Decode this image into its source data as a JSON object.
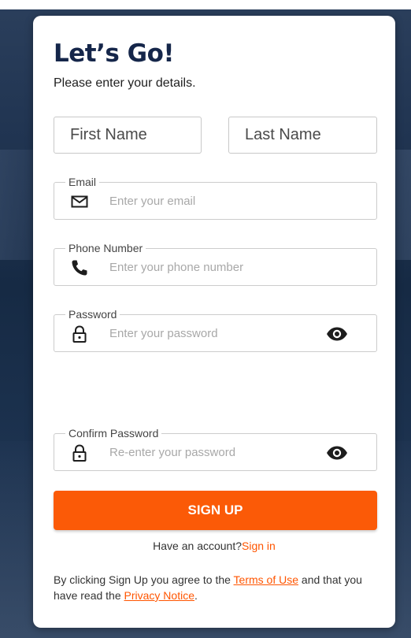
{
  "header": {
    "title": "Let’s Go!",
    "subtitle": "Please enter your details."
  },
  "form": {
    "first_name": {
      "placeholder": "First Name",
      "value": ""
    },
    "last_name": {
      "placeholder": "Last Name",
      "value": ""
    },
    "email": {
      "label": "Email",
      "placeholder": "Enter your email",
      "value": "",
      "icon": "envelope-icon"
    },
    "phone": {
      "label": "Phone Number",
      "placeholder": "Enter your phone number",
      "value": "",
      "icon": "phone-icon"
    },
    "password": {
      "label": "Password",
      "placeholder": "Enter your password",
      "value": "",
      "icon": "lock-icon",
      "toggle_icon": "eye-icon"
    },
    "confirm_password": {
      "label": "Confirm Password",
      "placeholder": "Re-enter your password",
      "value": "",
      "icon": "lock-icon",
      "toggle_icon": "eye-icon"
    }
  },
  "actions": {
    "signup_label": "SIGN UP",
    "have_account_text": "Have an account?",
    "signin_label": "Sign in"
  },
  "terms": {
    "prefix": "By clicking Sign Up you agree to the ",
    "terms_link": "Terms of Use",
    "middle": " and that you have read the ",
    "privacy_link": "Privacy Notice",
    "suffix": "."
  },
  "colors": {
    "accent": "#fb5a07",
    "link": "#ff5500",
    "title": "#15264a",
    "border": "#cccccc",
    "placeholder": "#a8a8a8"
  }
}
